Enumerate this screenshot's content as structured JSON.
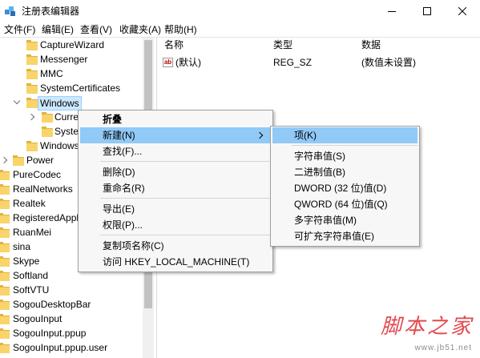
{
  "window": {
    "title": "注册表编辑器",
    "icon": "regedit-icon",
    "controls": [
      "minimize-icon",
      "maximize-icon",
      "close-icon"
    ]
  },
  "menubar": {
    "items": [
      "文件(F)",
      "编辑(E)",
      "查看(V)",
      "收藏夹(A)",
      "帮助(H)"
    ]
  },
  "tree": {
    "icon": "folder-icon",
    "items": [
      {
        "label": "CaptureWizard"
      },
      {
        "label": "Messenger"
      },
      {
        "label": "MMC"
      },
      {
        "label": "SystemCertificates"
      },
      {
        "label": "Windows",
        "expander": "chevron-down-icon",
        "selected": true
      },
      {
        "label": "Curre",
        "expander": "chevron-right-icon"
      },
      {
        "label": "Syste"
      },
      {
        "label": "Windows"
      },
      {
        "label": "Power",
        "expander": "chevron-right-icon"
      },
      {
        "label": "PureCodec"
      },
      {
        "label": "RealNetworks"
      },
      {
        "label": "Realtek"
      },
      {
        "label": "RegisteredAppl"
      },
      {
        "label": "RuanMei"
      },
      {
        "label": "sina"
      },
      {
        "label": "Skype"
      },
      {
        "label": "Softland"
      },
      {
        "label": "SoftVTU"
      },
      {
        "label": "SogouDesktopBar"
      },
      {
        "label": "SogouInput"
      },
      {
        "label": "SogouInput.ppup"
      },
      {
        "label": "SogouInput.ppup.user"
      }
    ]
  },
  "values_list": {
    "columns": [
      "名称",
      "类型",
      "数据"
    ],
    "rows": [
      {
        "icon": "string-value-icon",
        "icon_text": "ab",
        "name": "(默认)",
        "type": "REG_SZ",
        "data": "(数值未设置)"
      }
    ]
  },
  "context_menu": {
    "items": [
      {
        "label": "折叠",
        "bold": true
      },
      {
        "label": "新建(N)",
        "has_submenu": true,
        "highlighted": true
      },
      {
        "label": "查找(F)..."
      },
      {
        "label": "删除(D)"
      },
      {
        "label": "重命名(R)"
      },
      {
        "label": "导出(E)"
      },
      {
        "label": "权限(P)..."
      },
      {
        "label": "复制项名称(C)"
      },
      {
        "label": "访问 HKEY_LOCAL_MACHINE(T)"
      }
    ]
  },
  "submenu": {
    "items": [
      {
        "label": "项(K)",
        "highlighted": true
      },
      {
        "label": "字符串值(S)"
      },
      {
        "label": "二进制值(B)"
      },
      {
        "label": "DWORD (32 位)值(D)"
      },
      {
        "label": "QWORD (64 位)值(Q)"
      },
      {
        "label": "多字符串值(M)"
      },
      {
        "label": "可扩充字符串值(E)"
      }
    ]
  },
  "watermark": {
    "brand": "脚本之家",
    "url": "www.jb51.net"
  },
  "colors": {
    "menu_highlight": "#91c9f7",
    "tree_selection": "#cce8ff",
    "folder": "#f8d46a",
    "folder_back": "#e2b23a",
    "watermark": "#e0363c",
    "string_icon": "#c00000"
  }
}
